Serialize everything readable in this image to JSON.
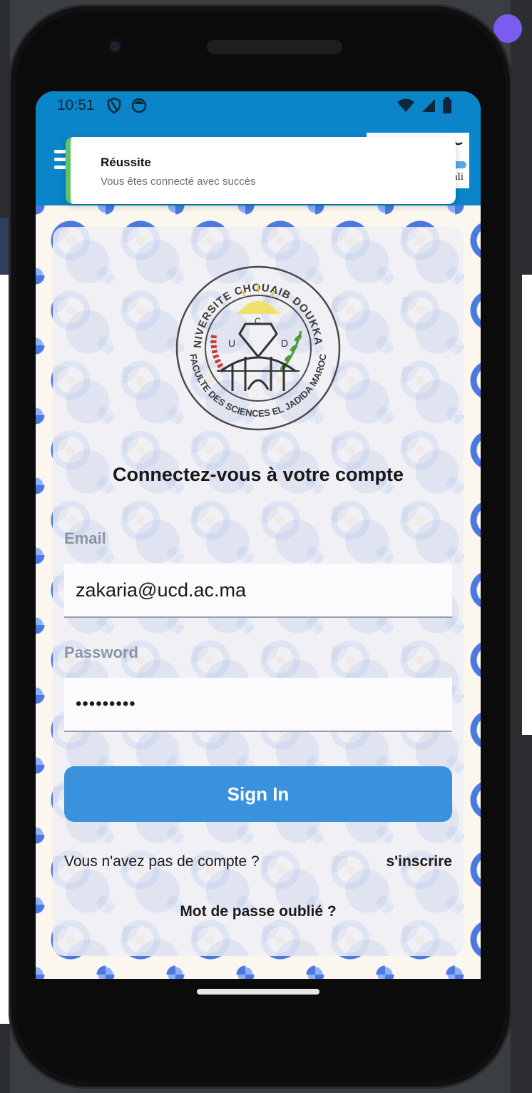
{
  "status_bar": {
    "time": "10:51"
  },
  "notification": {
    "title": "Réussite",
    "message": "Vous êtes connecté avec succès"
  },
  "header": {
    "logo_alt": "kali"
  },
  "emblem": {
    "top_text": "UNIVERSITE CHOUAIB DOUKKALI",
    "bottom_text": "FACULTE DES SCIENCES EL JADIDA MAROC",
    "letters": [
      "U",
      "C",
      "D"
    ]
  },
  "login": {
    "title": "Connectez-vous à votre compte",
    "email_label": "Email",
    "email_value": "zakaria@ucd.ac.ma",
    "password_label": "Password",
    "password_value": "•••••••••",
    "sign_in_label": "Sign In",
    "no_account_text": "Vous n'avez pas de compte ?",
    "signup_label": "s'inscrire",
    "forgot_label": "Mot de passe oublié ?"
  },
  "colors": {
    "app_bar": "#0a85c9",
    "primary_button": "#3a92dc",
    "toast_accent": "#5fc26a",
    "pattern_blue": "#4b79e0",
    "pattern_gold": "#f5b861"
  },
  "icons": {
    "status_left": [
      "shield-icon",
      "face-icon"
    ],
    "status_right": [
      "wifi-icon",
      "signal-icon",
      "battery-icon"
    ],
    "app_bar": [
      "menu-icon"
    ]
  }
}
